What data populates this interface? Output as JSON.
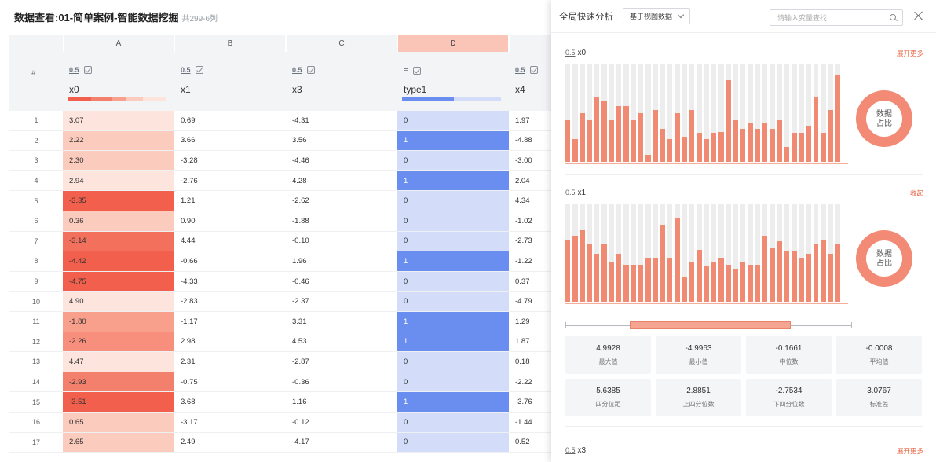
{
  "title": "数据查看:01-简单案例-智能数据挖掘",
  "subtitle": "共299-6列",
  "grid": {
    "hash": "#",
    "columns": [
      "A",
      "B",
      "C",
      "D"
    ],
    "selected_column": "D",
    "num_icon": "0.5",
    "list_icon": "≡",
    "variables": [
      "x0",
      "x1",
      "x3",
      "type1",
      "x4"
    ],
    "rows": [
      {
        "n": "1",
        "x0": "3.07",
        "x1": "0.69",
        "x3": "-4.31",
        "type1": "0",
        "x4": "1.97"
      },
      {
        "n": "2",
        "x0": "2.22",
        "x1": "3.66",
        "x3": "3.56",
        "type1": "1",
        "x4": "-4.88"
      },
      {
        "n": "3",
        "x0": "2.30",
        "x1": "-3.28",
        "x3": "-4.46",
        "type1": "0",
        "x4": "-3.00"
      },
      {
        "n": "4",
        "x0": "2.94",
        "x1": "-2.76",
        "x3": "4.28",
        "type1": "1",
        "x4": "2.04"
      },
      {
        "n": "5",
        "x0": "-3.35",
        "x1": "1.21",
        "x3": "-2.62",
        "type1": "0",
        "x4": "4.34"
      },
      {
        "n": "6",
        "x0": "0.36",
        "x1": "0.90",
        "x3": "-1.88",
        "type1": "0",
        "x4": "-1.02"
      },
      {
        "n": "7",
        "x0": "-3.14",
        "x1": "4.44",
        "x3": "-0.10",
        "type1": "0",
        "x4": "-2.73"
      },
      {
        "n": "8",
        "x0": "-4.42",
        "x1": "-0.66",
        "x3": "1.96",
        "type1": "1",
        "x4": "-1.22"
      },
      {
        "n": "9",
        "x0": "-4.75",
        "x1": "-4.33",
        "x3": "-0.46",
        "type1": "0",
        "x4": "0.37"
      },
      {
        "n": "10",
        "x0": "4.90",
        "x1": "-2.83",
        "x3": "-2.37",
        "type1": "0",
        "x4": "-4.79"
      },
      {
        "n": "11",
        "x0": "-1.80",
        "x1": "-1.17",
        "x3": "3.31",
        "type1": "1",
        "x4": "1.29"
      },
      {
        "n": "12",
        "x0": "-2.26",
        "x1": "2.98",
        "x3": "4.53",
        "type1": "1",
        "x4": "1.87"
      },
      {
        "n": "13",
        "x0": "4.47",
        "x1": "2.31",
        "x3": "-2.87",
        "type1": "0",
        "x4": "0.18"
      },
      {
        "n": "14",
        "x0": "-2.93",
        "x1": "-0.75",
        "x3": "-0.36",
        "type1": "0",
        "x4": "-2.22"
      },
      {
        "n": "15",
        "x0": "-3.51",
        "x1": "3.68",
        "x3": "1.16",
        "type1": "1",
        "x4": "-3.76"
      },
      {
        "n": "16",
        "x0": "0.65",
        "x1": "-3.17",
        "x3": "-0.12",
        "type1": "0",
        "x4": "-1.44"
      },
      {
        "n": "17",
        "x0": "2.65",
        "x1": "2.49",
        "x3": "-4.17",
        "type1": "0",
        "x4": "0.52"
      }
    ],
    "x0_shades": [
      "#fde5de",
      "#fbcbbd",
      "#fbcbbd",
      "#fde5de",
      "#f25f4c",
      "#fbcbbd",
      "#f3705d",
      "#f25f4c",
      "#f25f4c",
      "#fde5de",
      "#f9a08d",
      "#f88f7c",
      "#fde5de",
      "#f3806c",
      "#f25f4c",
      "#fbcbbd",
      "#fbcbbd"
    ],
    "type1_colors": {
      "0": "#d3dcf8",
      "1": "#6a8ef0"
    }
  },
  "panel": {
    "title": "全局快速分析",
    "dropdown": "基于视图数据",
    "search_placeholder": "请输入变量查找",
    "sections": [
      {
        "icon": "0.5",
        "var": "x0",
        "action": "展开更多",
        "donut": "数据\n占比",
        "bars": [
          0.43,
          0.23,
          0.5,
          0.43,
          0.66,
          0.63,
          0.43,
          0.57,
          0.57,
          0.43,
          0.5,
          0.07,
          0.53,
          0.34,
          0.23,
          0.5,
          0.26,
          0.53,
          0.3,
          0.23,
          0.3,
          0.31,
          0.84,
          0.43,
          0.34,
          0.4,
          0.34,
          0.4,
          0.34,
          0.43,
          0.15,
          0.3,
          0.3,
          0.37,
          0.67,
          0.3,
          0.53,
          0.89
        ]
      },
      {
        "icon": "0.5",
        "var": "x1",
        "action": "收起",
        "donut": "数据\n占比",
        "bars": [
          0.64,
          0.68,
          0.73,
          0.6,
          0.49,
          0.6,
          0.41,
          0.49,
          0.38,
          0.38,
          0.38,
          0.45,
          0.45,
          0.79,
          0.45,
          0.86,
          0.26,
          0.41,
          0.53,
          0.37,
          0.41,
          0.45,
          0.38,
          0.34,
          0.41,
          0.38,
          0.38,
          0.68,
          0.55,
          0.62,
          0.52,
          0.52,
          0.45,
          0.49,
          0.6,
          0.64,
          0.49,
          0.6
        ]
      },
      {
        "icon": "0.5",
        "var": "x3",
        "action": "展开更多"
      }
    ],
    "stats": [
      {
        "v": "4.9928",
        "k": "最大值"
      },
      {
        "v": "-4.9963",
        "k": "最小值"
      },
      {
        "v": "-0.1661",
        "k": "中位数"
      },
      {
        "v": "-0.0008",
        "k": "平均值"
      },
      {
        "v": "5.6385",
        "k": "四分位距"
      },
      {
        "v": "2.8851",
        "k": "上四分位数"
      },
      {
        "v": "-2.7534",
        "k": "下四分位数"
      },
      {
        "v": "3.0767",
        "k": "标准差"
      }
    ],
    "boxplot": {
      "min": -4.9963,
      "q1": -2.7534,
      "median": -0.1661,
      "q3": 2.8851,
      "max": 4.9928
    }
  }
}
